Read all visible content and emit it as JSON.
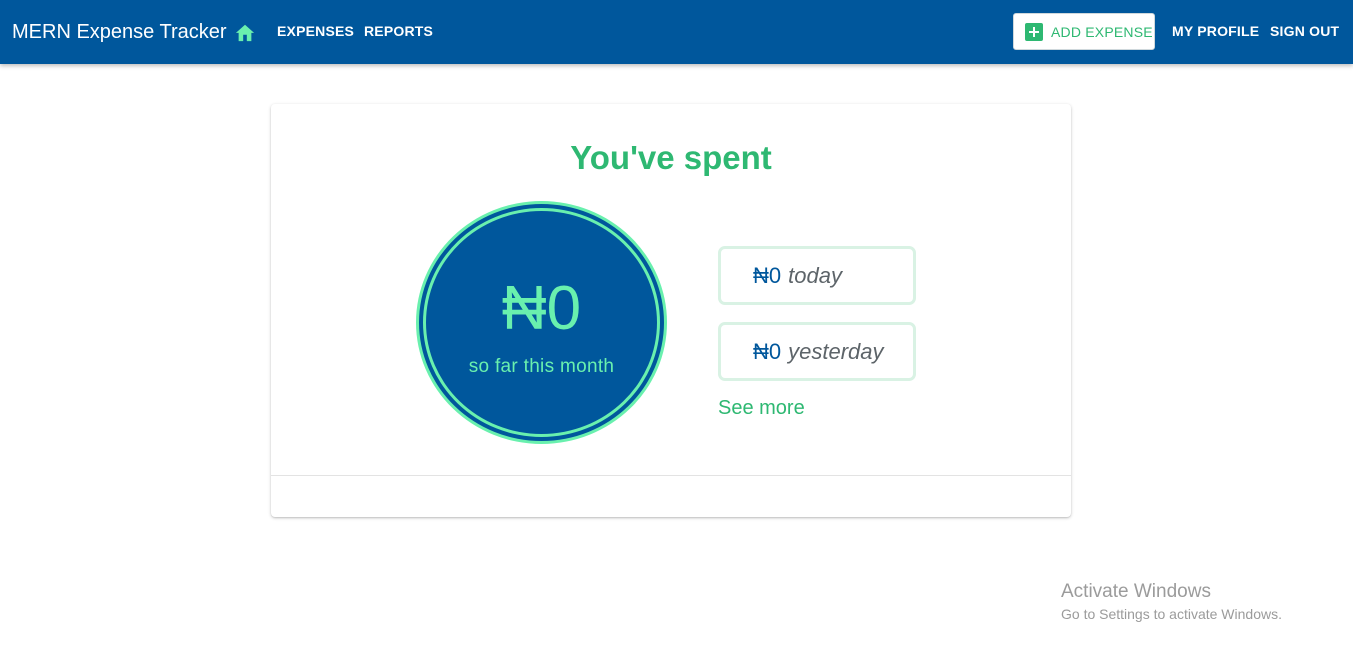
{
  "app": {
    "title": "MERN Expense Tracker",
    "home_icon": "home-icon"
  },
  "nav": {
    "expenses": "EXPENSES",
    "reports": "REPORTS",
    "add_expense": "ADD EXPENSE",
    "add_icon": "add-box-icon",
    "my_profile": "MY PROFILE",
    "sign_out": "SIGN OUT"
  },
  "summary": {
    "title": "You've spent",
    "month_total": "₦0",
    "month_label": "so far this month",
    "today_amount": "₦0",
    "today_label": "today",
    "yesterday_amount": "₦0",
    "yesterday_label": "yesterday",
    "see_more": "See more"
  },
  "os_watermark": {
    "line1": "Activate Windows",
    "line2": "Go to Settings to activate Windows."
  },
  "colors": {
    "primary": "#00579c",
    "accent_green": "#2eb872",
    "accent_mint": "#69f0ae",
    "box_border": "#d9f2e4"
  }
}
